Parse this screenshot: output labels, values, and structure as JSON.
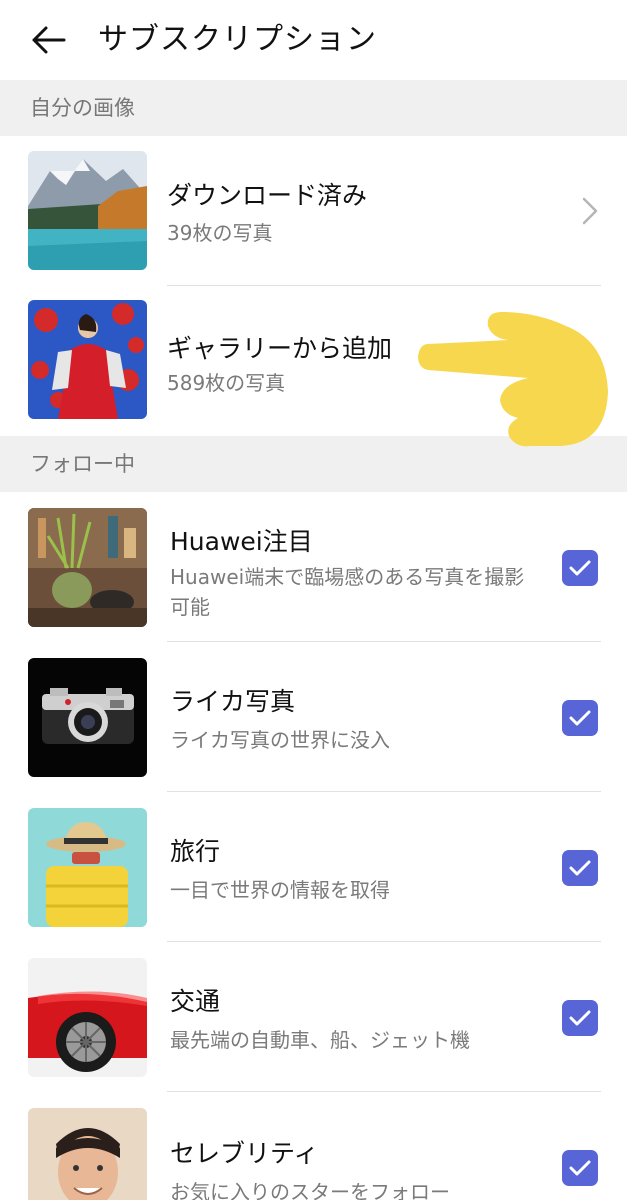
{
  "header": {
    "title": "サブスクリプション"
  },
  "sections": {
    "my_images": "自分の画像",
    "following": "フォロー中"
  },
  "my_images": [
    {
      "title": "ダウンロード済み",
      "subtitle": "39枚の写真"
    },
    {
      "title": "ギャラリーから追加",
      "subtitle": "589枚の写真"
    }
  ],
  "following": [
    {
      "title": "Huawei注目",
      "subtitle": "Huawei端末で臨場感のある写真を撮影可能",
      "checked": true
    },
    {
      "title": "ライカ写真",
      "subtitle": "ライカ写真の世界に没入",
      "checked": true
    },
    {
      "title": "旅行",
      "subtitle": "一目で世界の情報を取得",
      "checked": true
    },
    {
      "title": "交通",
      "subtitle": "最先端の自動車、船、ジェット機",
      "checked": true
    },
    {
      "title": "セレブリティ",
      "subtitle": "お気に入りのスターをフォロー",
      "checked": true
    }
  ],
  "colors": {
    "accent": "#5865d7",
    "section_bg": "#f0f0f0",
    "hand": "#f7d74e"
  },
  "icons": {
    "back": "arrow-left-icon",
    "chevron": "chevron-right-icon",
    "check": "checkmark-icon",
    "annotation": "pointing-hand-emoji"
  }
}
